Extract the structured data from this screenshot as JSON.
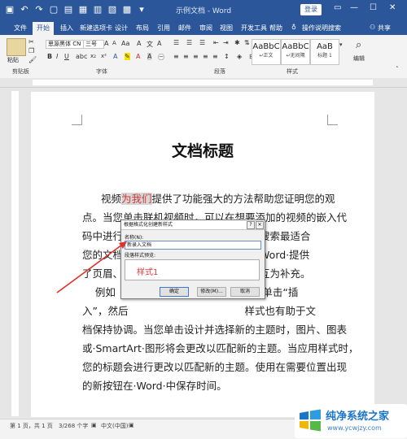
{
  "window": {
    "title": "示例文档  -  Word",
    "login": "登录",
    "controls": [
      "▭",
      "—",
      "☐",
      "✕"
    ],
    "qat_icons": [
      "save-icon",
      "undo-icon",
      "redo-icon",
      "new-doc-icon",
      "open-icon",
      "print-preview-icon",
      "print-icon",
      "template-icon",
      "table-icon",
      "customize-icon"
    ]
  },
  "tabs": [
    "文件",
    "开始",
    "插入",
    "新建选项卡",
    "设计",
    "布局",
    "引用",
    "邮件",
    "审阅",
    "视图",
    "开发工具",
    "帮助"
  ],
  "tell_me": "操作说明搜索",
  "share": "共享",
  "ribbon": {
    "paste": "粘贴",
    "font_name": "思源黑体 CN",
    "font_size": "三号",
    "groups": [
      "剪贴板",
      "字体",
      "段落",
      "样式"
    ],
    "styles": [
      {
        "preview": "AaBbC",
        "name": "↵正文"
      },
      {
        "preview": "AaBbC",
        "name": "↵无间隔"
      },
      {
        "preview": "AaB",
        "name": "标题 1"
      }
    ],
    "edit": "编辑"
  },
  "document": {
    "heading": "文档标题",
    "lines": [
      {
        "pre": "视频",
        "hl": "为我们",
        "post": "提供了功能强大的方法帮助您证明您的观"
      },
      {
        "text": "点。当您单击联机视频时，可以在想要添加的视频的嵌入代"
      },
      {
        "text": "码中进行                                    联机搜索最适合"
      },
      {
        "text": "您的文档                                    观，Word·提供"
      },
      {
        "text": "了页眉、                                    计可互为补充。"
      },
      {
        "text": "    例如                                    要栏。单击“插"
      },
      {
        "text": "入”，然后                                    样式也有助于文"
      },
      {
        "text": "档保持协调。当您单击设计并选择新的主题时，图片、图表"
      },
      {
        "text": "或·SmartArt·图形将会更改以匹配新的主题。当应用样式时，"
      },
      {
        "text": "您的标题会进行更改以匹配新的主题。使用在需要位置出现"
      },
      {
        "text": "的新按钮在·Word·中保存时间。"
      }
    ]
  },
  "dialog": {
    "title": "根据格式化创建新样式",
    "help": "?",
    "close": "✕",
    "name_label": "名称(N):",
    "name_value": "新录入文档",
    "preview_label": "段落样式预览:",
    "preview_text": "样式1",
    "ok": "确定",
    "modify": "修改(M)...",
    "cancel": "取消"
  },
  "status": {
    "page": "第 1 页，共 1 页",
    "words": "3/268 个字",
    "lang": "中文(中国)"
  },
  "watermark": {
    "title": "纯净系统之家",
    "url": "www.ycwjzy.com"
  },
  "colors": {
    "accent": "#2b579a",
    "highlight_text": "#d23a3a",
    "arrow": "#e0302a"
  }
}
